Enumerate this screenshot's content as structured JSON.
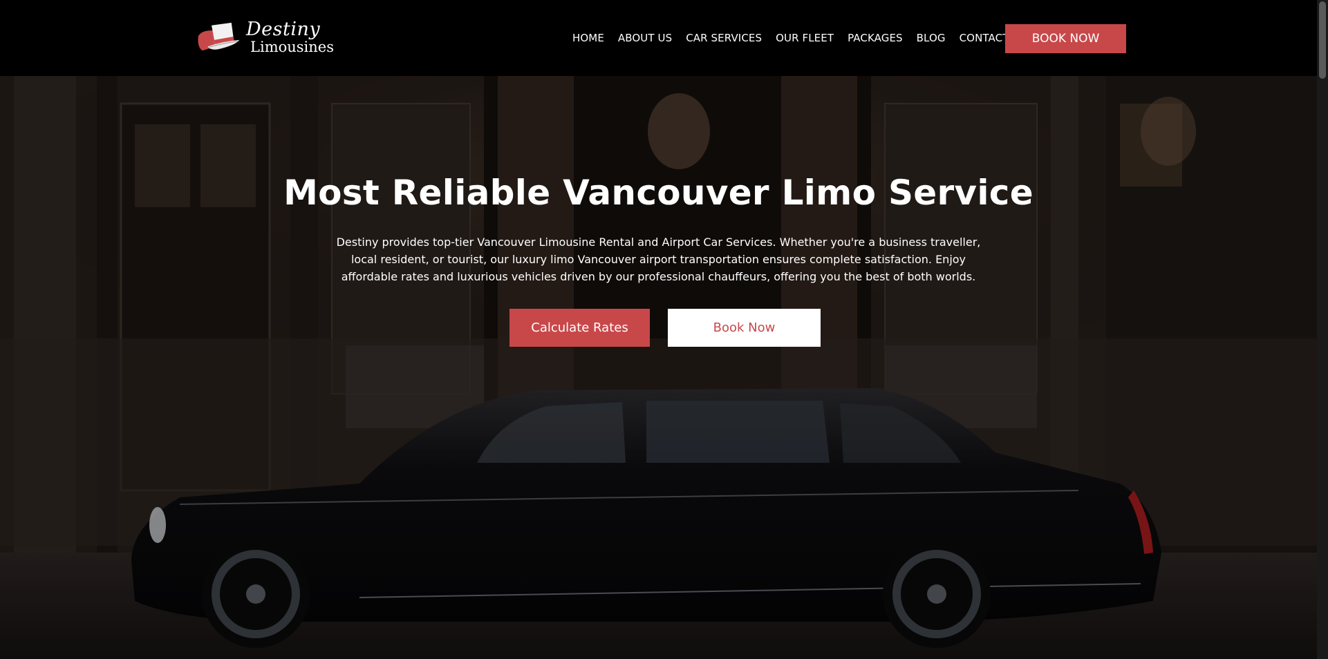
{
  "brand": {
    "name_line1": "Destiny",
    "name_line2": "Limousines",
    "accent": "#c8484a"
  },
  "nav": {
    "items": [
      {
        "label": "HOME"
      },
      {
        "label": "ABOUT US"
      },
      {
        "label": "CAR SERVICES"
      },
      {
        "label": "OUR FLEET"
      },
      {
        "label": "PACKAGES"
      },
      {
        "label": "BLOG"
      },
      {
        "label": "CONTACT"
      }
    ],
    "cta_label": "BOOK NOW"
  },
  "hero": {
    "title": "Most Reliable Vancouver Limo Service",
    "description": "Destiny provides top-tier Vancouver Limousine Rental and Airport Car Services. Whether you're a business traveller, local resident, or tourist, our luxury limo Vancouver airport transportation ensures complete satisfaction. Enjoy affordable rates and luxurious vehicles driven by our professional chauffeurs, offering you the best of both worlds.",
    "primary_button": "Calculate Rates",
    "secondary_button": "Book Now"
  }
}
